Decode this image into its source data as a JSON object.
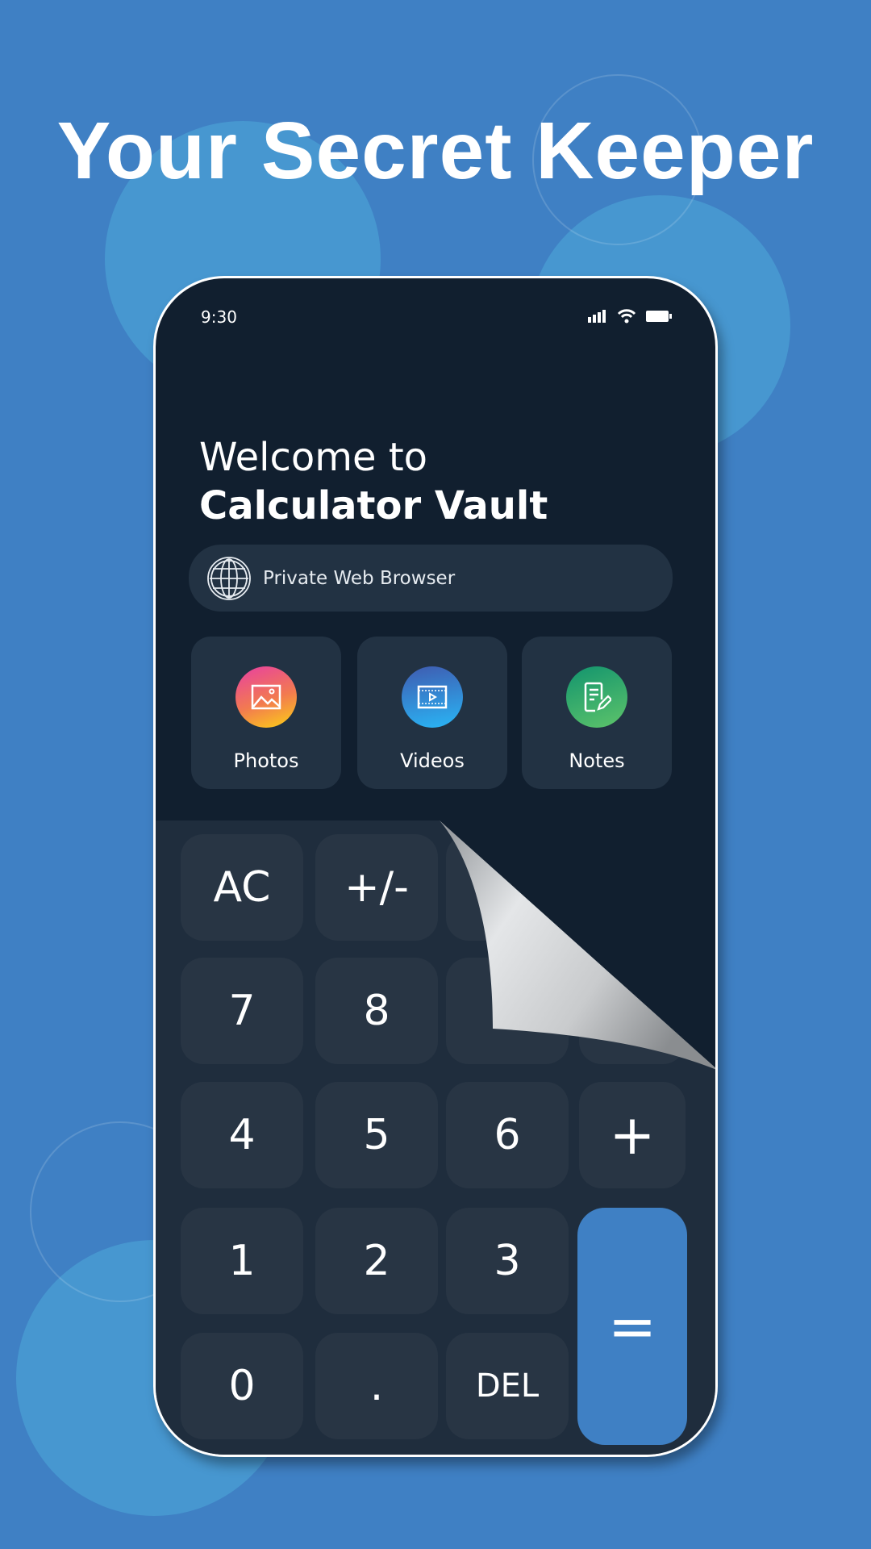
{
  "headline": "Your Secret Keeper",
  "status_bar": {
    "time": "9:30",
    "icons": [
      "signal-icon",
      "wifi-icon",
      "battery-icon"
    ]
  },
  "welcome": {
    "line1": "Welcome to",
    "line2": "Calculator Vault"
  },
  "browser": {
    "label": "Private Web Browser",
    "icon": "globe-icon"
  },
  "tiles": [
    {
      "label": "Photos",
      "icon": "image-icon"
    },
    {
      "label": "Videos",
      "icon": "film-icon"
    },
    {
      "label": "Notes",
      "icon": "note-edit-icon"
    }
  ],
  "keys": {
    "ac": "AC",
    "plusminus": "+/-",
    "k7": "7",
    "k8": "8",
    "k4": "4",
    "k5": "5",
    "k6": "6",
    "plus": "+",
    "k1": "1",
    "k2": "2",
    "k3": "3",
    "equals": "=",
    "k0": "0",
    "dot": ".",
    "del": "DEL"
  },
  "colors": {
    "background": "#3f80c4",
    "phone": "#111f2f",
    "keypad": "#1f2d3d",
    "key": "#283544",
    "accent": "#3f80c4"
  }
}
